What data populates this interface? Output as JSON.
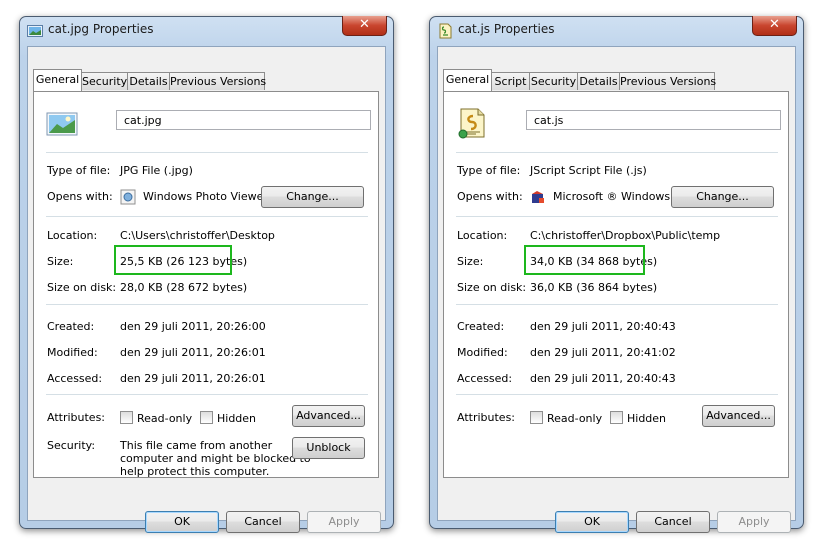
{
  "left": {
    "title": "cat.jpg Properties",
    "tabs": [
      "General",
      "Security",
      "Details",
      "Previous Versions"
    ],
    "filename": "cat.jpg",
    "rows": {
      "type_label": "Type of file:",
      "type_value": "JPG File (.jpg)",
      "opens_label": "Opens with:",
      "opens_value": "Windows Photo Viewer",
      "change_label": "Change...",
      "location_label": "Location:",
      "location_value": "C:\\Users\\christoffer\\Desktop",
      "size_label": "Size:",
      "size_value": "25,5 KB (26 123 bytes)",
      "disk_label": "Size on disk:",
      "disk_value": "28,0 KB (28 672 bytes)",
      "created_label": "Created:",
      "created_value": "den 29 juli 2011, 20:26:00",
      "modified_label": "Modified:",
      "modified_value": "den 29 juli 2011, 20:26:01",
      "accessed_label": "Accessed:",
      "accessed_value": "den 29 juli 2011, 20:26:01",
      "attributes_label": "Attributes:",
      "readonly_label": "Read-only",
      "hidden_label": "Hidden",
      "advanced_label": "Advanced...",
      "security_label": "Security:",
      "security_text_1": "This file came from another",
      "security_text_2": "computer and might be blocked to",
      "security_text_3": "help protect this computer.",
      "unblock_label": "Unblock"
    },
    "buttons": {
      "ok": "OK",
      "cancel": "Cancel",
      "apply": "Apply"
    }
  },
  "right": {
    "title": "cat.js Properties",
    "tabs": [
      "General",
      "Script",
      "Security",
      "Details",
      "Previous Versions"
    ],
    "filename": "cat.js",
    "rows": {
      "type_label": "Type of file:",
      "type_value": "JScript Script File (.js)",
      "opens_label": "Opens with:",
      "opens_value": "Microsoft ® Windows B",
      "change_label": "Change...",
      "location_label": "Location:",
      "location_value": "C:\\christoffer\\Dropbox\\Public\\temp",
      "size_label": "Size:",
      "size_value": "34,0 KB (34 868 bytes)",
      "disk_label": "Size on disk:",
      "disk_value": "36,0 KB (36 864 bytes)",
      "created_label": "Created:",
      "created_value": "den 29 juli 2011, 20:40:43",
      "modified_label": "Modified:",
      "modified_value": "den 29 juli 2011, 20:41:02",
      "accessed_label": "Accessed:",
      "accessed_value": "den 29 juli 2011, 20:40:43",
      "attributes_label": "Attributes:",
      "readonly_label": "Read-only",
      "hidden_label": "Hidden",
      "advanced_label": "Advanced..."
    },
    "buttons": {
      "ok": "OK",
      "cancel": "Cancel",
      "apply": "Apply"
    }
  },
  "icons": {
    "close": "close-icon",
    "jpg_file": "image-file-icon",
    "js_file": "script-file-icon",
    "photo_viewer": "photo-viewer-icon",
    "windows_script_host": "windows-script-host-icon"
  },
  "colors": {
    "highlight": "#1db71d",
    "close_button": "#c9452e",
    "frame": "#bcd2ea"
  }
}
